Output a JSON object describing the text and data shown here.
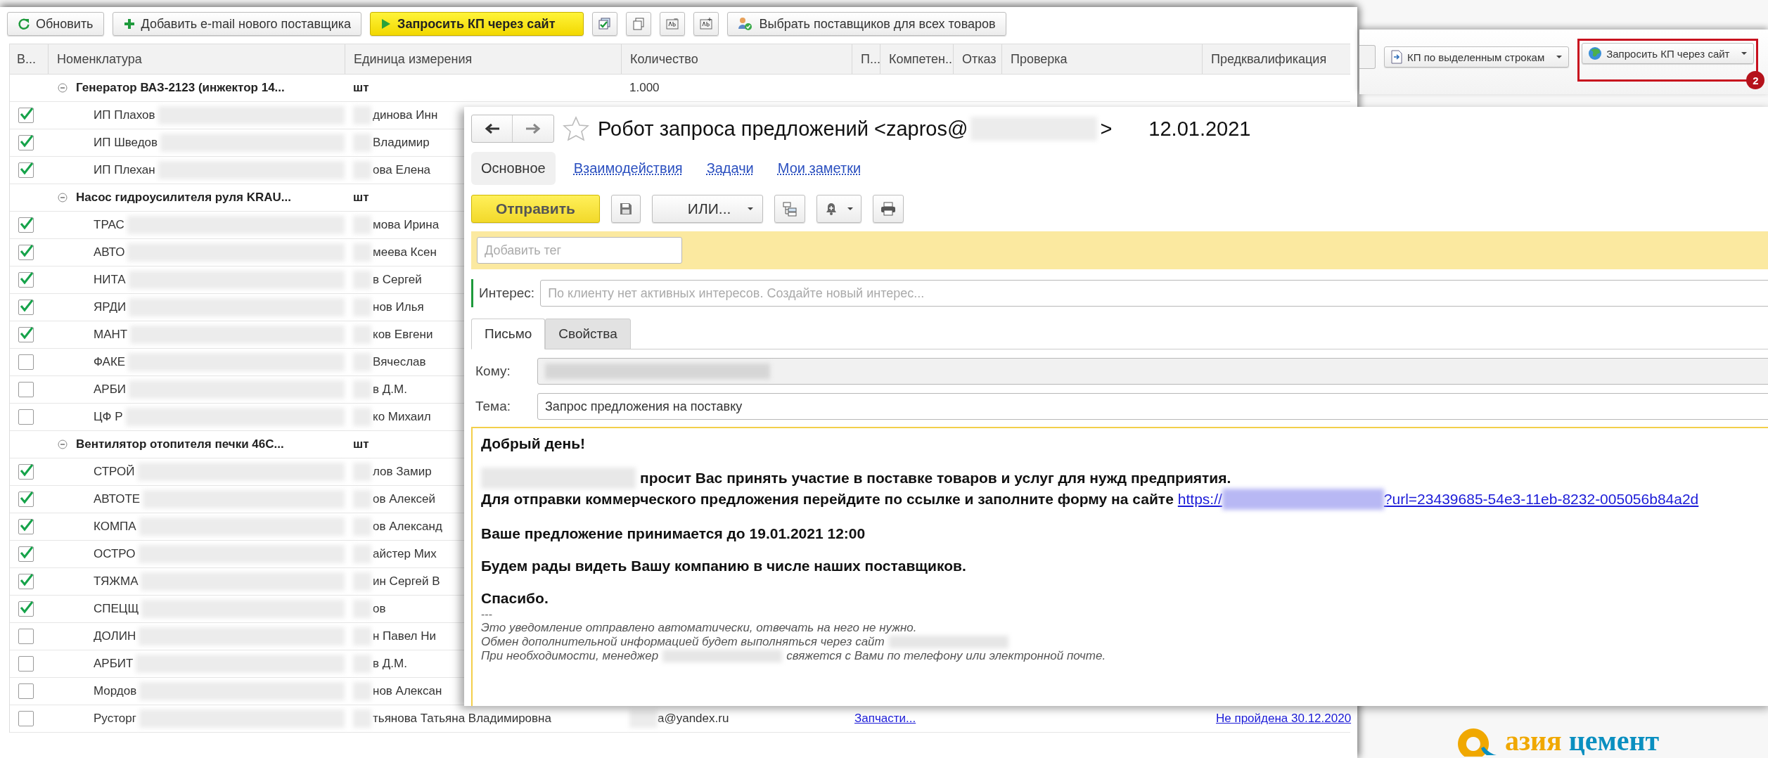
{
  "list_window": {
    "toolbar": {
      "buttons": [
        {
          "label": "Обновить",
          "kind": "refresh"
        },
        {
          "label": "Добавить e-mail нового поставщика",
          "kind": "add"
        },
        {
          "label": "Запросить КП через сайт",
          "kind": "primary"
        },
        {
          "label": "Выбрать поставщиков для всех товаров",
          "kind": "suppliers"
        }
      ]
    },
    "columns": [
      "В...",
      "Номенклатура",
      "Единица измерения",
      "Количество",
      "П...",
      "Компетен...",
      "Отказ",
      "Проверка",
      "Предквалификация"
    ],
    "rows": [
      {
        "kind": "group",
        "name": "Генератор ВАЗ-2123 (инжектор 14...",
        "unit": "шт",
        "quantity": "1.000"
      },
      {
        "kind": "supplier",
        "checked": true,
        "name": "ИП Плахов",
        "contact": "динова Инн"
      },
      {
        "kind": "supplier",
        "checked": true,
        "name": "ИП Шведов",
        "contact": "Владимир"
      },
      {
        "kind": "supplier",
        "checked": true,
        "name": "ИП Плехан",
        "contact": "ова Елена"
      },
      {
        "kind": "group",
        "name": "Насос гидроусилителя руля KRAU...",
        "unit": "шт"
      },
      {
        "kind": "supplier",
        "checked": true,
        "name": "ТРАС",
        "contact": "мова Ирина"
      },
      {
        "kind": "supplier",
        "checked": true,
        "name": "АВТО",
        "contact": "меева Ксен"
      },
      {
        "kind": "supplier",
        "checked": true,
        "name": "НИТА",
        "contact": "в Сергей"
      },
      {
        "kind": "supplier",
        "checked": true,
        "name": "ЯРДИ",
        "contact": "нов Илья"
      },
      {
        "kind": "supplier",
        "checked": true,
        "name": "МАНТ",
        "contact": "ков Евгени"
      },
      {
        "kind": "supplier",
        "checked": false,
        "name": "ФАКЕ",
        "contact": "Вячеслав"
      },
      {
        "kind": "supplier",
        "checked": false,
        "name": "АРБИ",
        "contact": "в Д.М."
      },
      {
        "kind": "supplier",
        "checked": false,
        "name": "ЦФ Р",
        "contact": "ко Михаил"
      },
      {
        "kind": "group",
        "name": "Вентилятор отопителя печки 46С...",
        "unit": "шт"
      },
      {
        "kind": "supplier",
        "checked": true,
        "name": "СТРОЙ",
        "contact": "лов Замир"
      },
      {
        "kind": "supplier",
        "checked": true,
        "name": "АВТОТЕ",
        "contact": "ов Алексей"
      },
      {
        "kind": "supplier",
        "checked": true,
        "name": "КОМПА",
        "contact": "ов Александ"
      },
      {
        "kind": "supplier",
        "checked": true,
        "name": "ОСТРО",
        "contact": "айстер Мих"
      },
      {
        "kind": "supplier",
        "checked": true,
        "name": "ТЯЖМА",
        "contact": "ин Сергей В"
      },
      {
        "kind": "supplier",
        "checked": true,
        "name": "СПЕЦЩ",
        "contact": "ов"
      },
      {
        "kind": "supplier",
        "checked": false,
        "name": "ДОЛИН",
        "contact": "н Павел Ни"
      },
      {
        "kind": "supplier",
        "checked": false,
        "name": "АРБИТ",
        "contact": "в Д.М."
      },
      {
        "kind": "supplier",
        "checked": false,
        "name": "Мордов",
        "contact": "нов Алексан"
      },
      {
        "kind": "supplier",
        "checked": false,
        "name": "Русторг",
        "contact": "тьянова Татьяна Владимировна",
        "email": "a@yandex.ru",
        "category": "Запчасти...",
        "prequalification": "Не пройдена 30.12.2020"
      }
    ]
  },
  "side_toolbar": {
    "buttons": [
      {
        "label": "КП по выделенным строкам",
        "kind": "document",
        "highlighted": false
      },
      {
        "label": "Запросить КП через сайт",
        "kind": "globe",
        "highlighted": true
      }
    ],
    "callout_number": "2"
  },
  "email_window": {
    "title": "Робот запроса предложений <zapros@",
    "title_end": ">",
    "date": "12.01.2021",
    "tabs": [
      {
        "label": "Основное",
        "selected": true
      },
      {
        "label": "Взаимодействия",
        "selected": false
      },
      {
        "label": "Задачи",
        "selected": false
      },
      {
        "label": "Мои заметки",
        "selected": false
      }
    ],
    "send_button": "Отправить",
    "menu_button": "ИЛИ...",
    "tag_field": {
      "placeholder": "Добавить тег"
    },
    "interest": {
      "label": "Интерес:",
      "placeholder": "По клиенту нет активных интересов. Создайте новый интерес..."
    },
    "form_tabs": [
      {
        "label": "Письмо",
        "selected": true
      },
      {
        "label": "Свойства",
        "selected": false
      }
    ],
    "to": {
      "label": "Кому:"
    },
    "subject": {
      "label": "Тема:",
      "value": "Запрос предложения на поставку"
    },
    "body": {
      "greeting": "Добрый день!",
      "invite": "просит Вас принять участие в поставке товаров и услуг для нужд предприятия.",
      "instruction": "Для отправки коммерческого предложения перейдите по ссылке и заполните форму на сайте",
      "link_start": "https://",
      "link_end": "?url=23439685-54e3-11eb-8232-005056b84a2d",
      "deadline": "Ваше предложение принимается до 19.01.2021 12:00",
      "closing": "Будем рады видеть Вашу компанию в числе наших поставщиков.",
      "thanks": "Спасибо.",
      "separator": "---",
      "notes": [
        {
          "parts": [
            "Это уведомление отправлено автоматически, отвечать на него не нужно."
          ],
          "redacted_end": false
        },
        {
          "parts": [
            "Обмен дополнительной информацией будет выполняться через сайт"
          ],
          "redacted_end": true
        },
        {
          "parts": [
            "При необходимости, менеджер",
            "свяжется с Вами по телефону или электронной почте."
          ],
          "redacted_end": false
        }
      ]
    }
  },
  "logo": {
    "parts": [
      "азия",
      "цемент"
    ]
  }
}
